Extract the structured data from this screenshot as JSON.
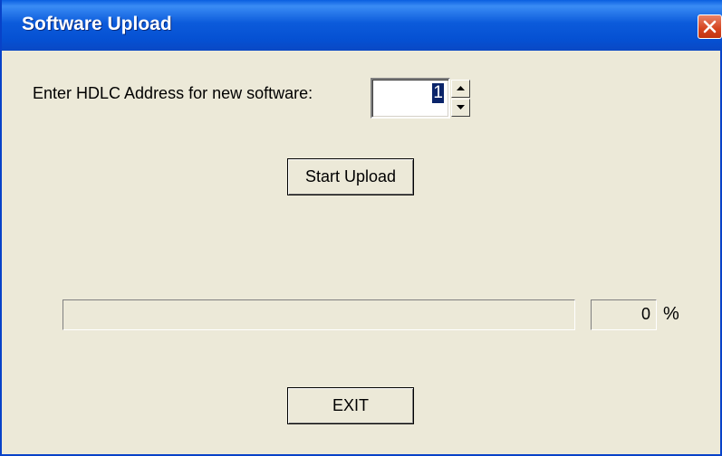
{
  "window": {
    "title": "Software Upload",
    "close_icon": "close-icon"
  },
  "form": {
    "address_label": "Enter HDLC Address for new software:",
    "address_value": "1",
    "start_button": "Start Upload"
  },
  "progress": {
    "percent_value": "0",
    "percent_sign": "%",
    "fill_fraction": 0
  },
  "footer": {
    "exit_button": "EXIT"
  },
  "colors": {
    "titlebar": "#0550D2",
    "close": "#D5431E",
    "face": "#ECE9D8",
    "selection": "#0A246A"
  }
}
